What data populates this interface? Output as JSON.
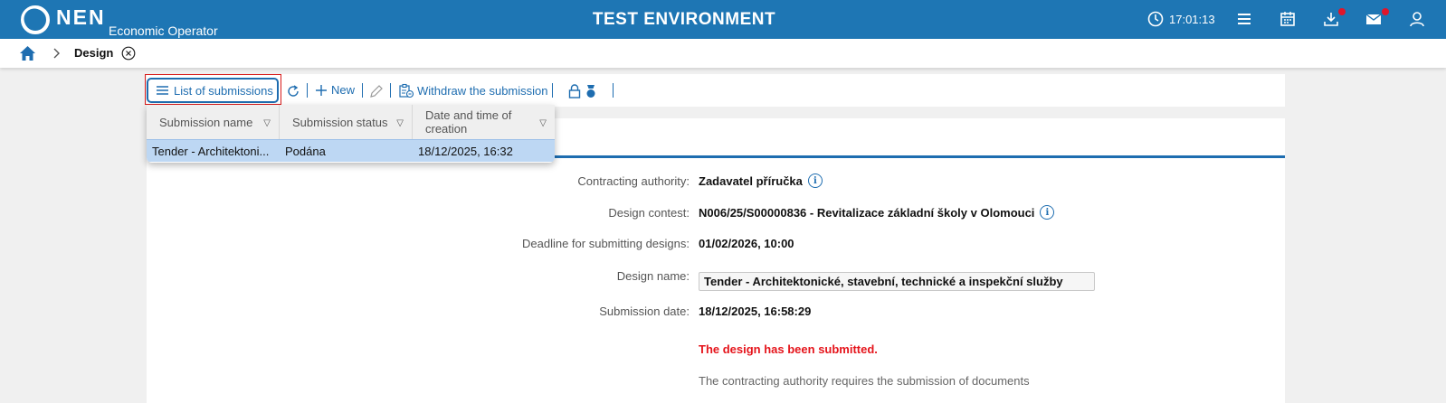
{
  "header": {
    "brand": "NEN",
    "subtitle": "Economic Operator",
    "environment": "TEST ENVIRONMENT",
    "time": "17:01:13",
    "colors": {
      "bar": "#1e76b4",
      "notification": "#e0162b"
    },
    "icons": [
      "clock-icon",
      "menu-icon",
      "calendar-icon",
      "download-icon",
      "mail-icon",
      "user-icon"
    ]
  },
  "breadcrumb": {
    "current": "Design"
  },
  "toolbar": {
    "list_label": "List of submissions",
    "new_label": "New",
    "withdraw_label": "Withdraw the submission"
  },
  "dropdown": {
    "columns": [
      "Submission name",
      "Submission status",
      "Date and time of creation"
    ],
    "rows": [
      {
        "name": "Tender - Architektoni...",
        "status": "Podána",
        "created": "18/12/2025, 16:32"
      }
    ]
  },
  "form": {
    "contracting_authority_label": "Contracting authority:",
    "contracting_authority": "Zadavatel příručka",
    "design_contest_label": "Design contest:",
    "design_contest": "N006/25/S00000836 - Revitalizace základní školy v Olomouci",
    "deadline_label": "Deadline for submitting designs:",
    "deadline": "01/02/2026, 10:00",
    "design_name_label": "Design name:",
    "design_name": "Tender - Architektonické, stavební, technické a inspekční služby",
    "submission_date_label": "Submission date:",
    "submission_date": "18/12/2025, 16:58:29",
    "status_message": "The design has been submitted.",
    "note": "The contracting authority requires the submission of documents"
  }
}
